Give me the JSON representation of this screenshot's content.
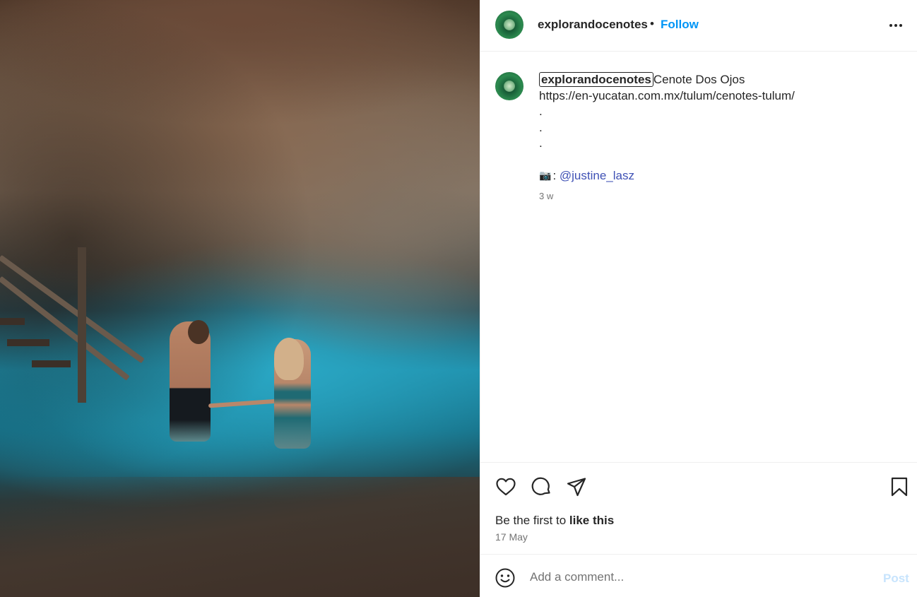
{
  "header": {
    "username": "explorandocenotes",
    "separator": "•",
    "follow_label": "Follow",
    "more_icon": "more-horizontal-icon"
  },
  "caption": {
    "username": "explorandocenotes",
    "title": "Cenote Dos Ojos",
    "link": "https://en-yucatan.com.mx/tulum/cenotes-tulum/",
    "dots": [
      ".",
      ".",
      "."
    ],
    "camera_emoji": "📷",
    "mention_prefix": ": ",
    "mention": "@justine_lasz",
    "time_ago": "3 w"
  },
  "actions": {
    "like_icon": "heart-icon",
    "comment_icon": "comment-icon",
    "share_icon": "share-icon",
    "save_icon": "bookmark-icon",
    "likes_prefix": "Be the first to ",
    "likes_strong": "like this",
    "date": "17 May"
  },
  "comment_bar": {
    "emoji_icon": "emoji-icon",
    "placeholder": "Add a comment...",
    "post_label": "Post"
  },
  "colors": {
    "accent": "#0095f6",
    "mention": "#3f51b5",
    "post_disabled": "#c7e4fd",
    "secondary_text": "#737373"
  }
}
